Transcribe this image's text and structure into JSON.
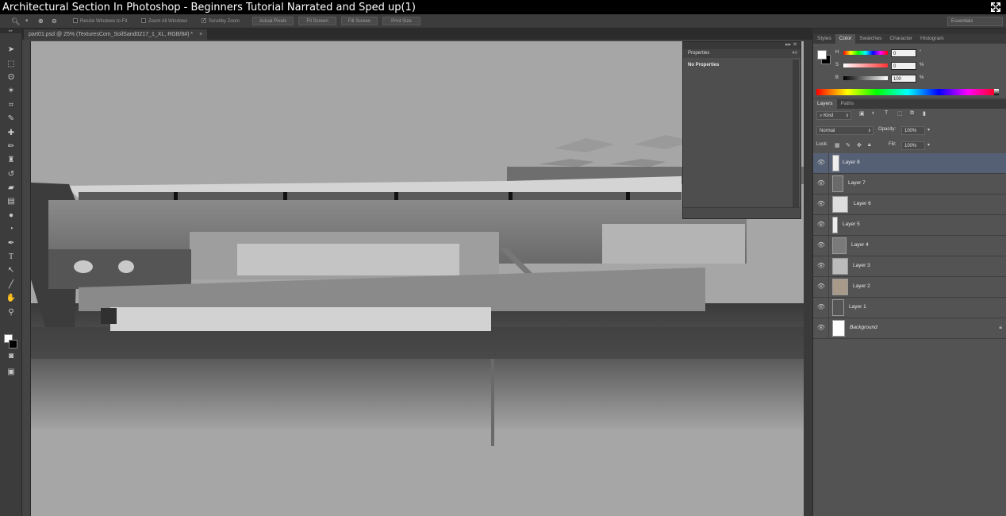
{
  "video_title": "Architectural Section In Photoshop - Beginners Tutorial Narrated and Sped up(1)",
  "options_bar": {
    "resize_windows": "Resize Windows to Fit",
    "zoom_all": "Zoom All Windows",
    "scrubby_zoom": "Scrubby Zoom",
    "actual_pixels": "Actual Pixels",
    "fit_screen": "Fit Screen",
    "fill_screen": "Fill Screen",
    "print_size": "Print Size",
    "workspace": "Essentials"
  },
  "document": {
    "tab_label": "part01.psd @ 25% (TexturesCom_SoilSand0217_1_XL, RGB/8#) *",
    "close": "×"
  },
  "properties_panel": {
    "tab": "Properties",
    "message": "No Properties"
  },
  "color_panel": {
    "tabs": [
      "Styles",
      "Color",
      "Swatches",
      "Character",
      "Histogram"
    ],
    "active_tab": "Color",
    "h_label": "H",
    "h_value": "0",
    "h_unit": "°",
    "s_label": "S",
    "s_value": "0",
    "s_unit": "%",
    "b_label": "B",
    "b_value": "100",
    "b_unit": "%"
  },
  "layers_panel": {
    "tabs": [
      "Layers",
      "Paths"
    ],
    "active_tab": "Layers",
    "filter": "Kind",
    "blend_mode": "Normal",
    "opacity_label": "Opacity:",
    "opacity_value": "100%",
    "lock_label": "Lock:",
    "fill_label": "Fill:",
    "fill_value": "100%",
    "layers": [
      {
        "name": "Layer 8",
        "selected": true
      },
      {
        "name": "Layer 7",
        "selected": false
      },
      {
        "name": "Layer 6",
        "selected": false
      },
      {
        "name": "Layer 5",
        "selected": false
      },
      {
        "name": "Layer 4",
        "selected": false
      },
      {
        "name": "Layer 3",
        "selected": false
      },
      {
        "name": "Layer 2",
        "selected": false
      },
      {
        "name": "Layer 1",
        "selected": false
      },
      {
        "name": "Background",
        "selected": false
      }
    ]
  },
  "colors": {
    "selected_layer": "#566075",
    "panel_bg": "#535353",
    "app_bg": "#323232"
  }
}
